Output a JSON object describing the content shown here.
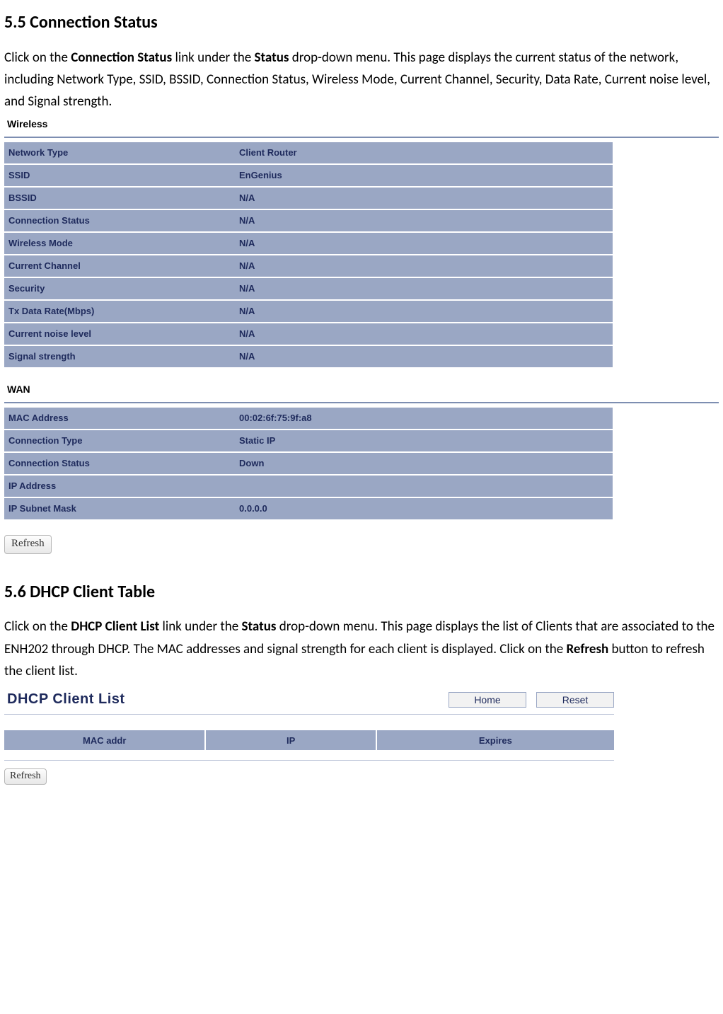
{
  "section55": {
    "heading": "5.5 Connection Status",
    "para_pre": "Click on the ",
    "para_bold1": "Connection Status",
    "para_mid1": " link under the ",
    "para_bold2": "Status",
    "para_post": " drop-down menu. This page displays the current status of the network, including Network Type, SSID, BSSID, Connection Status, Wireless Mode, Current Channel, Security, Data Rate, Current noise level, and Signal strength."
  },
  "wireless": {
    "title": "Wireless",
    "rows": [
      {
        "label": "Network Type",
        "value": "Client Router"
      },
      {
        "label": "SSID",
        "value": "EnGenius"
      },
      {
        "label": "BSSID",
        "value": "N/A"
      },
      {
        "label": "Connection Status",
        "value": "N/A"
      },
      {
        "label": "Wireless Mode",
        "value": "N/A"
      },
      {
        "label": "Current Channel",
        "value": "N/A"
      },
      {
        "label": "Security",
        "value": "N/A"
      },
      {
        "label": "Tx Data Rate(Mbps)",
        "value": "N/A"
      },
      {
        "label": "Current noise level",
        "value": "N/A"
      },
      {
        "label": "Signal strength",
        "value": "N/A"
      }
    ]
  },
  "wan": {
    "title": "WAN",
    "rows": [
      {
        "label": "MAC Address",
        "value": "00:02:6f:75:9f:a8"
      },
      {
        "label": "Connection Type",
        "value": "Static IP"
      },
      {
        "label": "Connection Status",
        "value": "Down"
      },
      {
        "label": "IP Address",
        "value": ""
      },
      {
        "label": "IP Subnet Mask",
        "value": "0.0.0.0"
      }
    ]
  },
  "refresh_label": "Refresh",
  "section56": {
    "heading": "5.6 DHCP Client Table",
    "para_pre": "Click on the ",
    "para_bold1": "DHCP Client List",
    "para_mid1": " link under the ",
    "para_bold2": "Status",
    "para_mid2": " drop-down menu. This page displays the list of Clients that are associated to the ENH202 through DHCP. The MAC addresses and signal strength for each client is displayed. Click on the ",
    "para_bold3": "Refresh",
    "para_post": " button to refresh the client list."
  },
  "dhcp": {
    "title": "DHCP Client List",
    "home_btn": "Home",
    "reset_btn": "Reset",
    "columns": [
      "MAC addr",
      "IP",
      "Expires"
    ]
  }
}
